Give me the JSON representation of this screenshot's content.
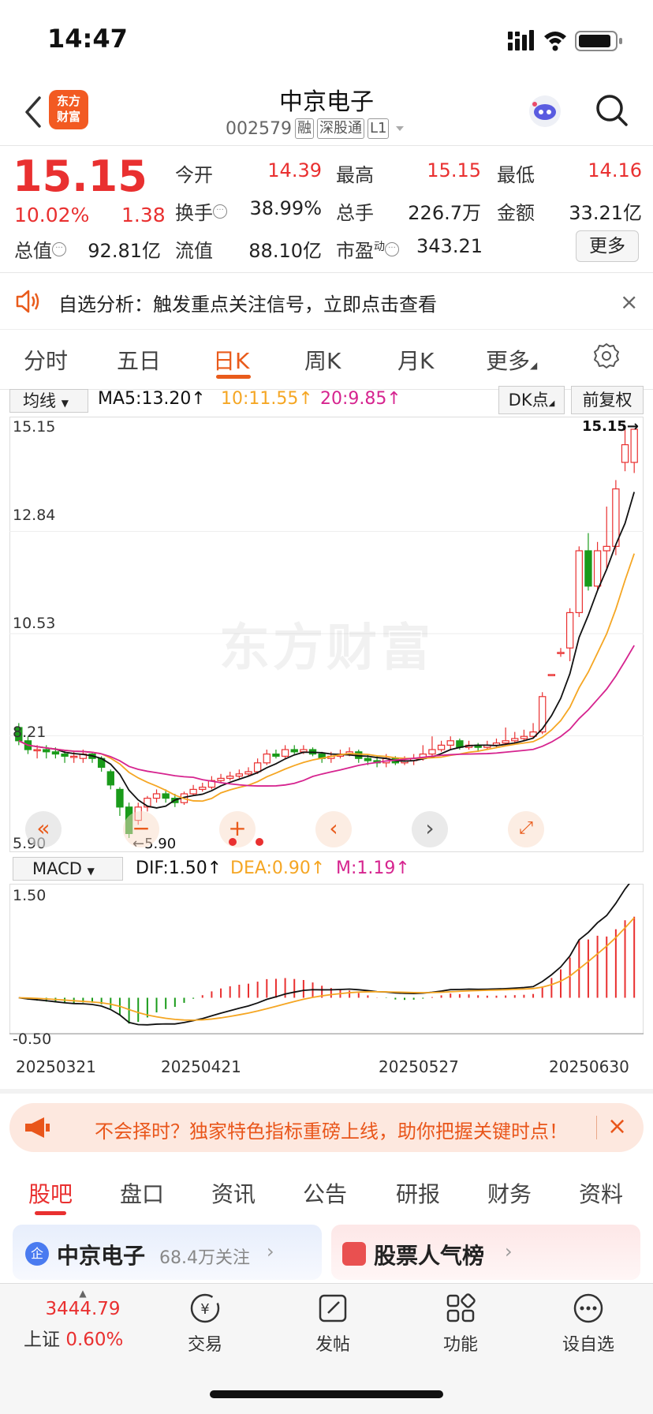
{
  "status_bar": {
    "time": "14:47"
  },
  "header": {
    "logo_text_1": "东方",
    "logo_text_2": "财富",
    "stock_name": "中京电子",
    "stock_code": "002579",
    "tags": [
      "融",
      "深股通",
      "L1"
    ]
  },
  "quote": {
    "price": "15.15",
    "change_pct": "10.02%",
    "change_amt": "1.38",
    "fields": {
      "open_label": "今开",
      "open": "14.39",
      "high_label": "最高",
      "high": "15.15",
      "low_label": "最低",
      "low": "14.16",
      "turnover_label": "换手",
      "turnover": "38.99%",
      "volume_label": "总手",
      "volume": "226.7万",
      "amount_label": "金额",
      "amount": "33.21亿",
      "total_cap_label": "总值",
      "total_cap": "92.81亿",
      "float_cap_label": "流值",
      "float_cap": "88.10亿",
      "pe_label": "市盈",
      "pe_sup": "动",
      "pe": "343.21"
    },
    "more_button": "更多"
  },
  "alert": {
    "text": "自选分析：触发重点关注信号，立即点击查看",
    "close": "×"
  },
  "period_tabs": [
    "分时",
    "五日",
    "日K",
    "周K",
    "月K",
    "更多"
  ],
  "active_period": "日K",
  "chart_toolbar": {
    "ma_select": "均线",
    "ma5": "MA5:13.20↑",
    "ma10": "10:11.55↑",
    "ma20": "20:9.85↑",
    "dk_button": "DK点",
    "adjust_button": "前复权"
  },
  "colors": {
    "up": "#e93030",
    "down": "#1a9b1a",
    "ma5": "#111111",
    "ma10": "#f5a623",
    "ma20": "#d6248f",
    "accent": "#e95b1b"
  },
  "chart_data": [
    {
      "type": "candlestick",
      "y_axis_labels": [
        "15.15",
        "12.84",
        "10.53",
        "8.21",
        "5.90"
      ],
      "ylim": [
        5.9,
        15.15
      ],
      "watermark": "东方财富",
      "low_marker": "←5.90",
      "high_marker": "15.15→",
      "series": [
        {
          "name": "MA5",
          "last": 13.2
        },
        {
          "name": "MA10",
          "last": 11.55
        },
        {
          "name": "MA20",
          "last": 9.85
        }
      ],
      "candles": [
        [
          8.4,
          8.1,
          8.5,
          8.0
        ],
        [
          8.1,
          7.9,
          8.2,
          7.8
        ],
        [
          7.9,
          7.9,
          8.0,
          7.7
        ],
        [
          7.9,
          7.85,
          8.0,
          7.7
        ],
        [
          7.85,
          7.8,
          7.95,
          7.7
        ],
        [
          7.8,
          7.75,
          7.9,
          7.6
        ],
        [
          7.75,
          7.75,
          7.85,
          7.6
        ],
        [
          7.7,
          7.8,
          7.9,
          7.6
        ],
        [
          7.8,
          7.7,
          7.85,
          7.6
        ],
        [
          7.7,
          7.5,
          7.75,
          7.4
        ],
        [
          7.4,
          7.1,
          7.45,
          7.0
        ],
        [
          7.0,
          6.6,
          7.05,
          6.4
        ],
        [
          6.6,
          6.0,
          6.7,
          5.9
        ],
        [
          6.3,
          6.6,
          6.7,
          6.2
        ],
        [
          6.6,
          6.8,
          6.85,
          6.5
        ],
        [
          6.8,
          6.9,
          7.0,
          6.7
        ],
        [
          6.9,
          6.8,
          7.0,
          6.7
        ],
        [
          6.8,
          6.7,
          6.9,
          6.6
        ],
        [
          6.7,
          6.9,
          6.95,
          6.65
        ],
        [
          6.9,
          7.0,
          7.1,
          6.85
        ],
        [
          7.0,
          7.05,
          7.15,
          6.95
        ],
        [
          7.05,
          7.2,
          7.3,
          7.0
        ],
        [
          7.2,
          7.25,
          7.35,
          7.15
        ],
        [
          7.25,
          7.3,
          7.4,
          7.2
        ],
        [
          7.3,
          7.35,
          7.45,
          7.25
        ],
        [
          7.35,
          7.4,
          7.5,
          7.3
        ],
        [
          7.4,
          7.6,
          7.7,
          7.35
        ],
        [
          7.6,
          7.8,
          7.9,
          7.55
        ],
        [
          7.8,
          7.75,
          7.9,
          7.7
        ],
        [
          7.75,
          7.9,
          8.0,
          7.7
        ],
        [
          7.9,
          7.85,
          8.0,
          7.8
        ],
        [
          7.85,
          7.9,
          8.0,
          7.8
        ],
        [
          7.9,
          7.8,
          7.95,
          7.75
        ],
        [
          7.8,
          7.7,
          7.85,
          7.6
        ],
        [
          7.7,
          7.75,
          7.85,
          7.6
        ],
        [
          7.75,
          7.8,
          7.9,
          7.7
        ],
        [
          7.8,
          7.85,
          7.95,
          7.75
        ],
        [
          7.85,
          7.7,
          7.9,
          7.6
        ],
        [
          7.7,
          7.65,
          7.8,
          7.55
        ],
        [
          7.65,
          7.6,
          7.75,
          7.5
        ],
        [
          7.6,
          7.7,
          7.8,
          7.5
        ],
        [
          7.7,
          7.6,
          7.75,
          7.55
        ],
        [
          7.6,
          7.65,
          7.75,
          7.55
        ],
        [
          7.65,
          7.7,
          7.8,
          7.55
        ],
        [
          7.7,
          7.8,
          8.0,
          7.65
        ],
        [
          7.8,
          7.9,
          8.2,
          7.75
        ],
        [
          7.9,
          8.0,
          8.1,
          7.85
        ],
        [
          8.0,
          8.1,
          8.2,
          7.9
        ],
        [
          8.1,
          7.95,
          8.15,
          7.9
        ],
        [
          7.95,
          8.0,
          8.1,
          7.9
        ],
        [
          8.0,
          7.95,
          8.05,
          7.85
        ],
        [
          7.95,
          8.0,
          8.1,
          7.9
        ],
        [
          8.0,
          8.05,
          8.15,
          7.95
        ],
        [
          8.05,
          8.1,
          8.4,
          8.0
        ],
        [
          8.1,
          8.15,
          8.3,
          8.05
        ],
        [
          8.15,
          8.2,
          8.35,
          8.1
        ],
        [
          8.2,
          8.3,
          8.5,
          8.15
        ],
        [
          8.3,
          9.1,
          9.2,
          8.25
        ],
        [
          9.6,
          9.6,
          9.6,
          9.6
        ],
        [
          10.1,
          10.1,
          10.2,
          10.0
        ],
        [
          10.2,
          11.0,
          11.1,
          9.9
        ],
        [
          11.0,
          12.4,
          12.5,
          10.9
        ],
        [
          12.4,
          11.6,
          12.8,
          11.5
        ],
        [
          11.6,
          12.4,
          12.6,
          11.5
        ],
        [
          12.4,
          12.5,
          13.4,
          12.0
        ],
        [
          12.5,
          13.8,
          14.0,
          12.3
        ],
        [
          14.4,
          14.8,
          15.15,
          14.2
        ],
        [
          14.4,
          15.15,
          15.15,
          14.16
        ]
      ]
    },
    {
      "type": "macd",
      "select": "MACD",
      "dif_label": "DIF:1.50↑",
      "dea_label": "DEA:0.90↑",
      "m_label": "M:1.19↑",
      "y_axis_labels": [
        "1.50",
        "-0.50"
      ],
      "ylim": [
        -0.5,
        1.5
      ],
      "dates": [
        "20250321",
        "20250421",
        "20250527",
        "20250630"
      ]
    }
  ],
  "promo": {
    "text": "不会择时？独家特色指标重磅上线，助你把握关键时点！",
    "close": "×"
  },
  "section_tabs": [
    "股吧",
    "盘口",
    "资讯",
    "公告",
    "研报",
    "财务",
    "资料"
  ],
  "cards": {
    "left_title": "中京电子",
    "left_sub": "68.4万关注",
    "right_title": "股票人气榜"
  },
  "bottom_nav": {
    "index_value": "3444.79",
    "index_name": "上证",
    "index_change": "0.60%",
    "items": [
      "交易",
      "发帖",
      "功能",
      "设自选"
    ]
  }
}
